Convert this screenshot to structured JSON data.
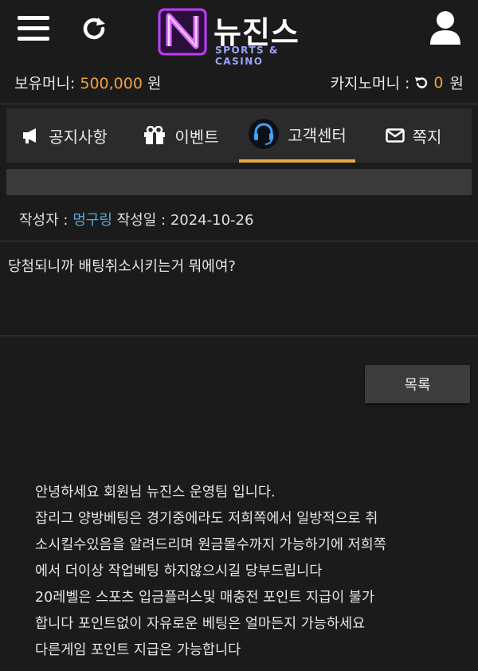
{
  "header": {
    "brand_name": "뉴진스",
    "brand_sub": "SPORTS & CASINO",
    "icons": [
      "menu-icon",
      "refresh-icon",
      "user-icon"
    ]
  },
  "wallet": {
    "balance_label": "보유머니:",
    "balance_value": "500,000",
    "balance_unit": "원",
    "casino_label": "카지노머니 :",
    "casino_value": "0",
    "casino_unit": "원"
  },
  "tabs": [
    {
      "label": "공지사항",
      "icon": "megaphone-icon"
    },
    {
      "label": "이벤트",
      "icon": "gift-icon"
    },
    {
      "label": "고객센터",
      "icon": "headset-icon",
      "active": true
    },
    {
      "label": "쪽지",
      "icon": "envelope-icon"
    }
  ],
  "post": {
    "author_label": "작성자 :",
    "author": "멍구링",
    "date_label": "작성일 :",
    "date": "2024-10-26",
    "content": "당첨되니까 배팅취소시키는거 뭐에여?"
  },
  "list_button": "목록",
  "reply": {
    "lines": [
      "안녕하세요 회원님 뉴진스 운영팀 입니다.",
      "잡리그 양방베팅은 경기중에라도 저희쪽에서 일방적으로 취",
      "소시킬수있음을 알려드리며 원금몰수까지 가능하기에 저희쪽",
      "에서 더이상 작업베팅 하지않으시길 당부드립니다",
      "20레벨은 스포츠 입금플러스및 매충전 포인트 지급이 불가",
      "합니다 포인트없이 자유로운 베팅은 얼마든지 가능하세요",
      "다른게임 포인트 지급은 가능합니다"
    ]
  },
  "colors": {
    "accent": "#f0a13b",
    "author": "#58a9e2",
    "tab_underline": "#e8a843",
    "background": "#1b1b1b"
  }
}
